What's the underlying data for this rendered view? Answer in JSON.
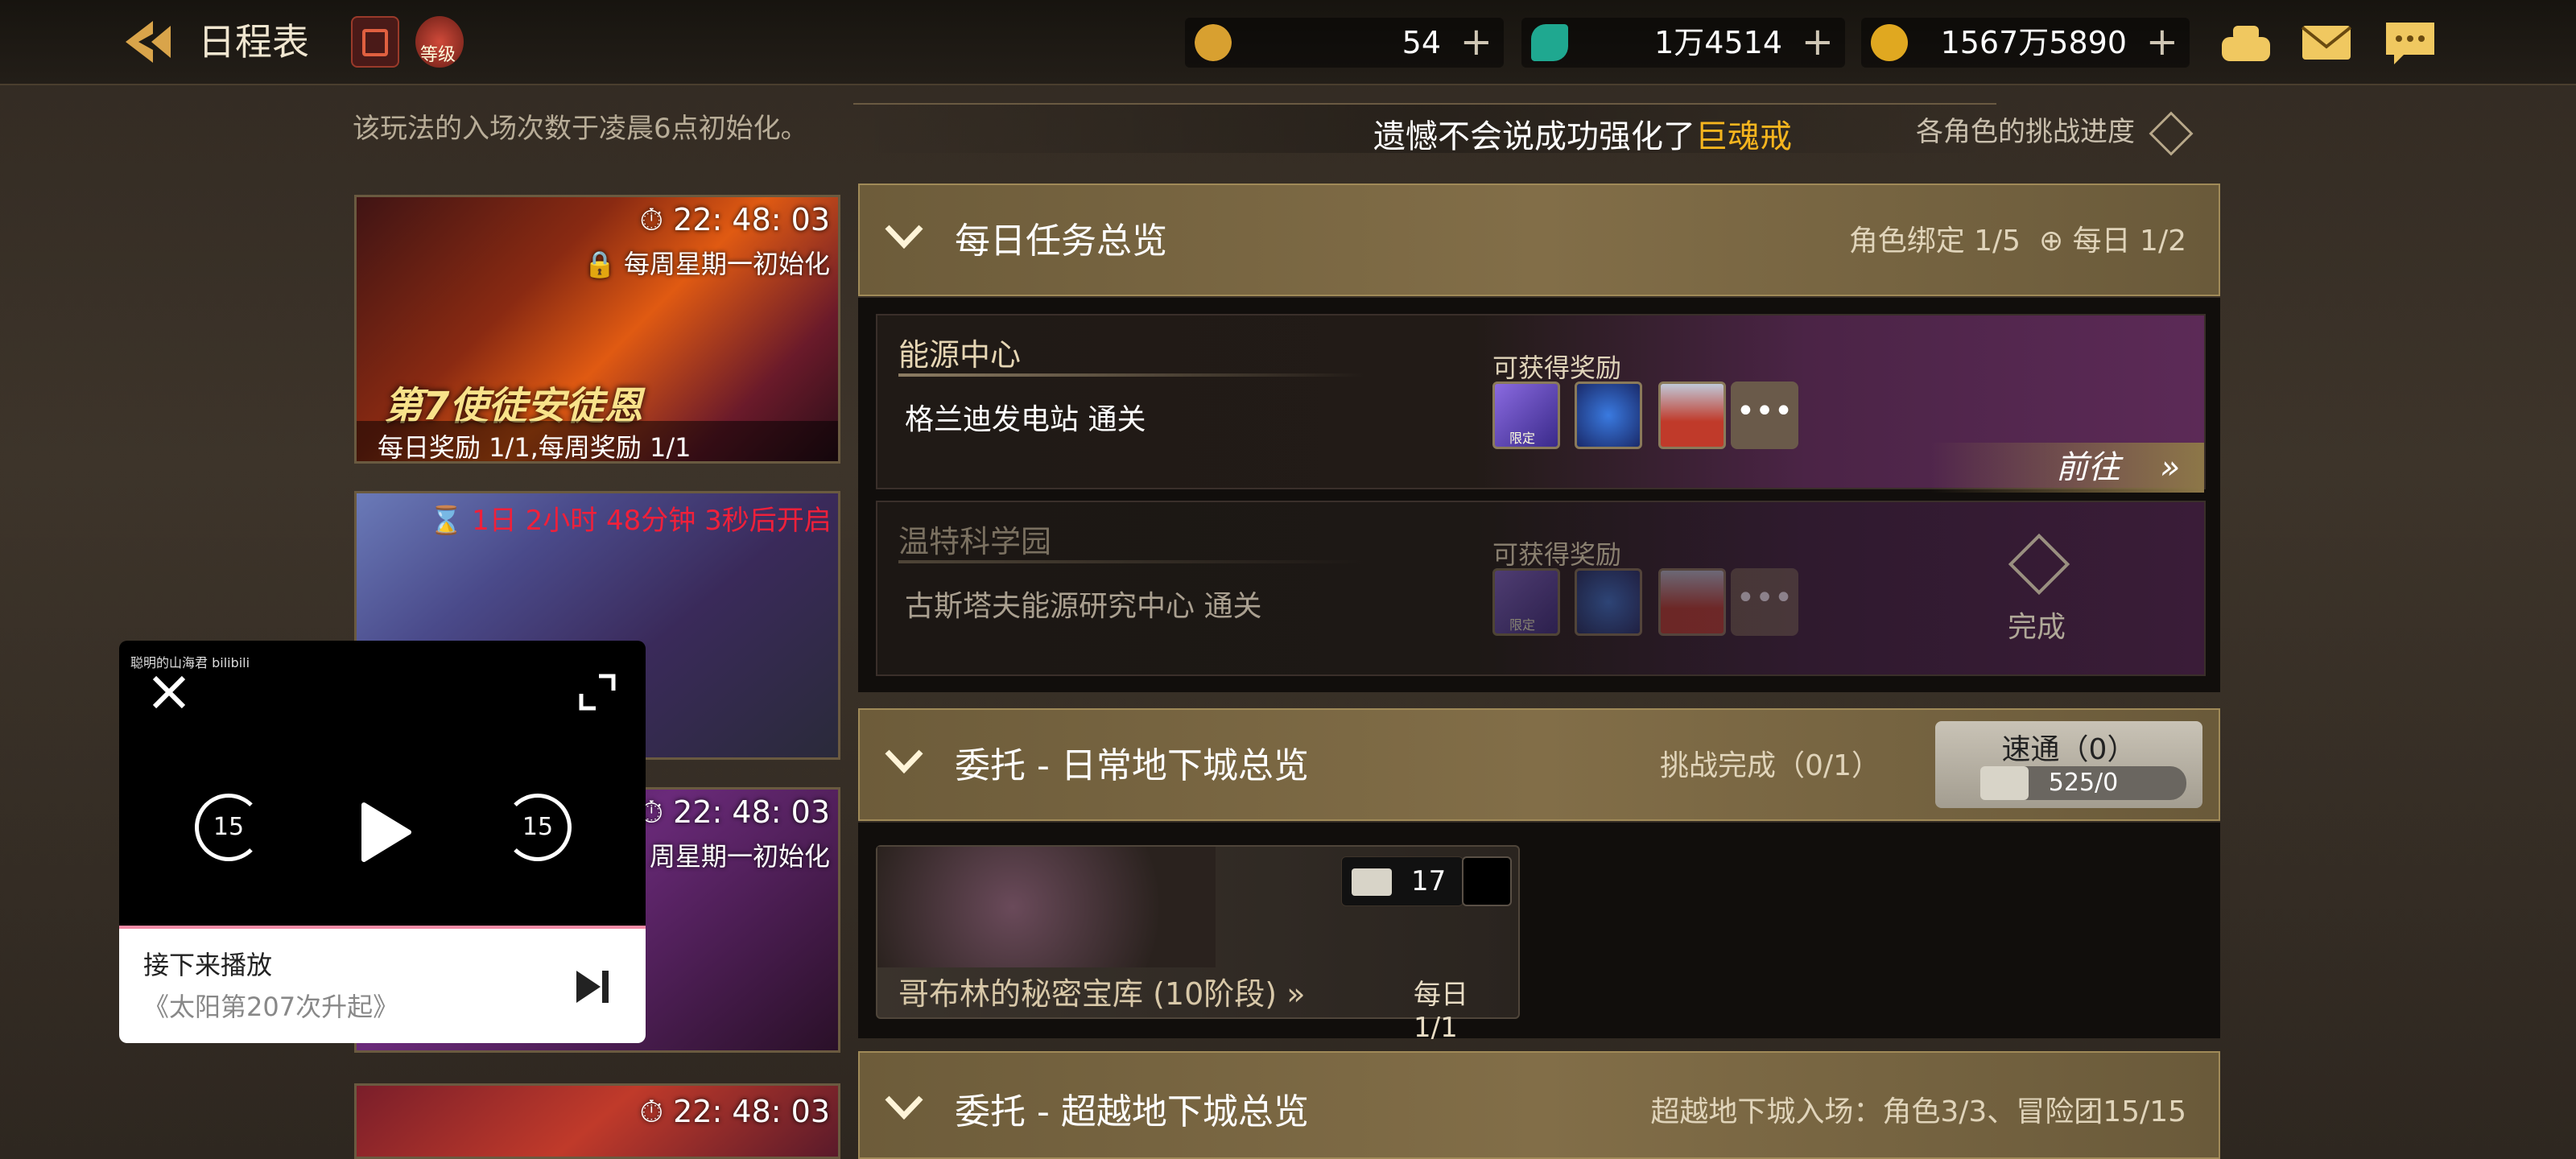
{
  "header": {
    "title": "日程表",
    "level_badge": "等级",
    "currencies": [
      {
        "icon": "moon-coin-icon",
        "value": "54"
      },
      {
        "icon": "green-gem-icon",
        "value": "1万4514"
      },
      {
        "icon": "gold-coin-icon",
        "value": "1567万5890"
      }
    ]
  },
  "notice": "该玩法的入场次数于凌晨6点初始化。",
  "banner": {
    "prefix": "遗憾不会说成功强化了",
    "highlight": "巨魂戒"
  },
  "progress_label": "各角色的挑战进度",
  "left_cards": [
    {
      "timer": "22: 48: 03",
      "reset": "每周星期一初始化",
      "event_title": "第7使徒安徒恩",
      "rewards": "每日奖励 1/1,每周奖励 1/1"
    },
    {
      "countdown": "1日 2小时 48分钟 3秒后开启"
    },
    {
      "timer": "22: 48: 03",
      "reset": "周星期一初始化"
    },
    {
      "timer": "22: 48: 03"
    }
  ],
  "daily_section": {
    "title": "每日任务总览",
    "bind": "角色绑定 1/5",
    "daily": "每日 1/2"
  },
  "quests": [
    {
      "name": "能源中心",
      "desc": "格兰迪发电站 通关",
      "reward_label": "可获得奖励",
      "badge": "限定",
      "action": "前往"
    },
    {
      "name": "温特科学园",
      "desc": "古斯塔夫能源研究中心 通关",
      "reward_label": "可获得奖励",
      "badge": "限定",
      "status": "完成"
    }
  ],
  "commission_daily": {
    "title": "委托 - 日常地下城总览",
    "challenge": "挑战完成（0/1）",
    "speed_label": "速通（0）",
    "speed_value": "525/0"
  },
  "dungeon": {
    "name": "哥布林的秘密宝库",
    "tier": "(10阶段)",
    "tickets": "17",
    "daily": "每日 1/1"
  },
  "commission_beyond": {
    "title": "委托 - 超越地下城总览",
    "entry": "超越地下城入场：角色3/3、冒险团15/15"
  },
  "video": {
    "brand": "聪明的山海君 bilibili",
    "up_next_label": "接下来播放",
    "next_title": "《太阳第207次升起》",
    "skip_back": "15",
    "skip_fwd": "15"
  }
}
